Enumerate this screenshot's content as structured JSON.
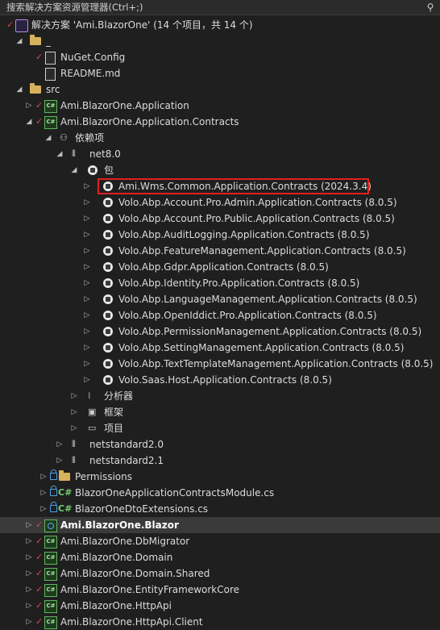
{
  "search": {
    "placeholder": "搜索解决方案资源管理器(Ctrl+;)",
    "icon": "search-icon"
  },
  "rows": [
    {
      "label": "解决方案 'Ami.BlazorOne' (14 个项目，共 14 个)",
      "icon": "solution-icon"
    },
    {
      "label": "_",
      "icon": "folder-icon"
    },
    {
      "label": "NuGet.Config",
      "icon": "config-file-icon"
    },
    {
      "label": "README.md",
      "icon": "markdown-file-icon"
    },
    {
      "label": "src",
      "icon": "folder-icon"
    },
    {
      "label": "Ami.BlazorOne.Application",
      "icon": "csharp-project-icon"
    },
    {
      "label": "Ami.BlazorOne.Application.Contracts",
      "icon": "csharp-project-icon"
    },
    {
      "label": "依赖项",
      "icon": "dependencies-icon"
    },
    {
      "label": "net8.0",
      "icon": "framework-icon"
    },
    {
      "label": "包",
      "icon": "package-icon"
    },
    {
      "label": "Ami.Wms.Common.Application.Contracts (2024.3.4)",
      "icon": "package-icon"
    },
    {
      "label": "Volo.Abp.Account.Pro.Admin.Application.Contracts (8.0.5)",
      "icon": "package-icon"
    },
    {
      "label": "Volo.Abp.Account.Pro.Public.Application.Contracts (8.0.5)",
      "icon": "package-icon"
    },
    {
      "label": "Volo.Abp.AuditLogging.Application.Contracts (8.0.5)",
      "icon": "package-icon"
    },
    {
      "label": "Volo.Abp.FeatureManagement.Application.Contracts (8.0.5)",
      "icon": "package-icon"
    },
    {
      "label": "Volo.Abp.Gdpr.Application.Contracts (8.0.5)",
      "icon": "package-icon"
    },
    {
      "label": "Volo.Abp.Identity.Pro.Application.Contracts (8.0.5)",
      "icon": "package-icon"
    },
    {
      "label": "Volo.Abp.LanguageManagement.Application.Contracts (8.0.5)",
      "icon": "package-icon"
    },
    {
      "label": "Volo.Abp.OpenIddict.Pro.Application.Contracts (8.0.5)",
      "icon": "package-icon"
    },
    {
      "label": "Volo.Abp.PermissionManagement.Application.Contracts (8.0.5)",
      "icon": "package-icon"
    },
    {
      "label": "Volo.Abp.SettingManagement.Application.Contracts (8.0.5)",
      "icon": "package-icon"
    },
    {
      "label": "Volo.Abp.TextTemplateManagement.Application.Contracts (8.0.5)",
      "icon": "package-icon"
    },
    {
      "label": "Volo.Saas.Host.Application.Contracts (8.0.5)",
      "icon": "package-icon"
    },
    {
      "label": "分析器",
      "icon": "analyzer-icon"
    },
    {
      "label": "框架",
      "icon": "framework-ref-icon"
    },
    {
      "label": "项目",
      "icon": "project-ref-icon"
    },
    {
      "label": "netstandard2.0",
      "icon": "framework-icon"
    },
    {
      "label": "netstandard2.1",
      "icon": "framework-icon"
    },
    {
      "label": "Permissions",
      "icon": "folder-icon"
    },
    {
      "label": "BlazorOneApplicationContractsModule.cs",
      "icon": "csharp-file-icon"
    },
    {
      "label": "BlazorOneDtoExtensions.cs",
      "icon": "csharp-file-icon"
    },
    {
      "label": "Ami.BlazorOne.Blazor",
      "icon": "web-project-icon"
    },
    {
      "label": "Ami.BlazorOne.DbMigrator",
      "icon": "csharp-project-icon"
    },
    {
      "label": "Ami.BlazorOne.Domain",
      "icon": "csharp-project-icon"
    },
    {
      "label": "Ami.BlazorOne.Domain.Shared",
      "icon": "csharp-project-icon"
    },
    {
      "label": "Ami.BlazorOne.EntityFrameworkCore",
      "icon": "csharp-project-icon"
    },
    {
      "label": "Ami.BlazorOne.HttpApi",
      "icon": "csharp-project-icon"
    },
    {
      "label": "Ami.BlazorOne.HttpApi.Client",
      "icon": "csharp-project-icon"
    }
  ],
  "colors": {
    "background": "#1f1f1f",
    "selected": "#3a3a3a",
    "highlight_border": "#e02020",
    "check": "#e0434b"
  }
}
